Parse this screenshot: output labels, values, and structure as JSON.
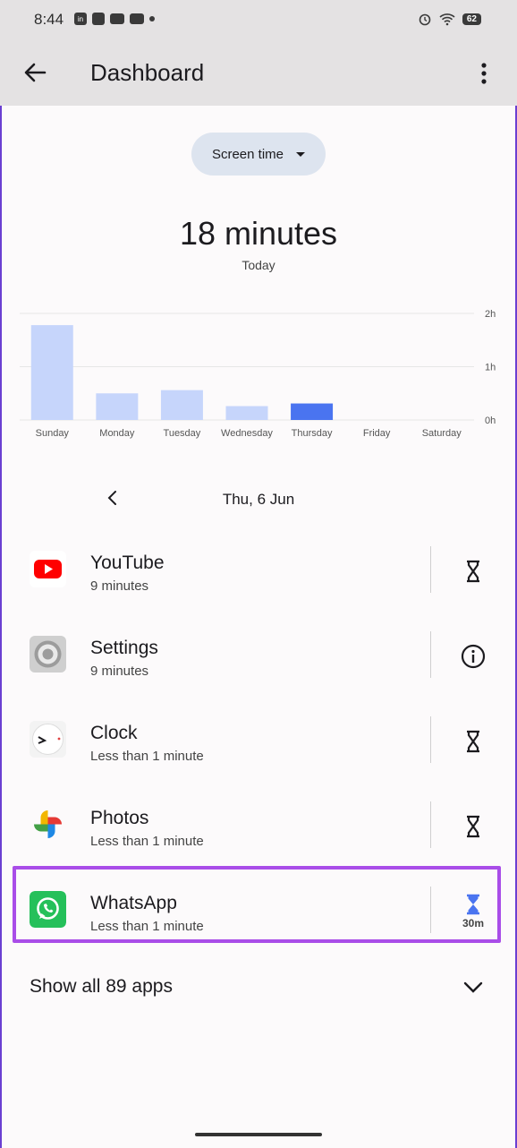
{
  "status_bar": {
    "time": "8:44",
    "battery": "62"
  },
  "header": {
    "title": "Dashboard"
  },
  "filter_chip": {
    "label": "Screen time"
  },
  "summary": {
    "total": "18 minutes",
    "period": "Today"
  },
  "chart_data": {
    "type": "bar",
    "categories": [
      "Sunday",
      "Monday",
      "Tuesday",
      "Wednesday",
      "Thursday",
      "Friday",
      "Saturday"
    ],
    "values": [
      1.78,
      0.5,
      0.56,
      0.26,
      0.31,
      0,
      0
    ],
    "unit": "hours",
    "ylim": [
      0,
      2
    ],
    "yticks": [
      "0h",
      "1h",
      "2h"
    ],
    "grid": true,
    "highlighted_category": "Thursday",
    "colors": {
      "default": "#c6d5fb",
      "highlight": "#4a74f0",
      "grid": "#e6e6e6"
    }
  },
  "date_nav": {
    "label": "Thu, 6 Jun"
  },
  "apps": [
    {
      "name": "YouTube",
      "usage": "9 minutes",
      "icon": "youtube-icon",
      "action": "hourglass-icon"
    },
    {
      "name": "Settings",
      "usage": "9 minutes",
      "icon": "settings-icon",
      "action": "info-icon"
    },
    {
      "name": "Clock",
      "usage": "Less than 1 minute",
      "icon": "clock-icon",
      "action": "hourglass-icon"
    },
    {
      "name": "Photos",
      "usage": "Less than 1 minute",
      "icon": "photos-icon",
      "action": "hourglass-icon"
    },
    {
      "name": "WhatsApp",
      "usage": "Less than 1 minute",
      "icon": "whatsapp-icon",
      "action": "hourglass-icon",
      "limit": "30m"
    }
  ],
  "show_all": {
    "label": "Show all 89 apps"
  },
  "colors": {
    "accent": "#4a74f0",
    "highlight_border": "#a94de8",
    "whatsapp": "#25c05a",
    "youtube": "#ff0000"
  }
}
